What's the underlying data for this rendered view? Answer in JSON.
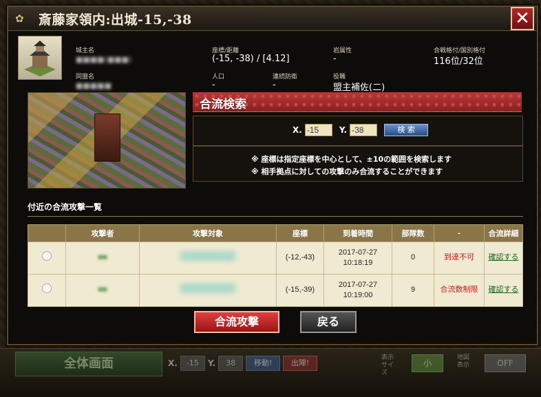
{
  "title": "斎藤家領内:出城-15,-38",
  "close_label": "✕",
  "info": {
    "owner_label": "城主名",
    "owner_value": "■■■■(■■■)",
    "alliance_label": "同盟名",
    "alliance_value": "■■■■■",
    "coords_label": "座標/距離",
    "coords_value": "(-15, -38)  /  [4.12]",
    "pop_label": "人口",
    "pop_value": "-",
    "defense_label": "連続防衛",
    "defense_value": "-",
    "rock_label": "岩属性",
    "rock_value": "-",
    "role_label": "役職",
    "role_value": "盟主補佐(二)",
    "rank_label": "合戦格付/国別格付",
    "rank_value": "116位/32位"
  },
  "search": {
    "header": "合流検索",
    "x_label": "X.",
    "x_value": "-15",
    "y_label": "Y.",
    "y_value": "-38",
    "button": "検 索",
    "note1": "※ 座標は指定座標を中心として、±10の範囲を検索します",
    "note2": "※ 相手拠点に対しての攻撃のみ合流することができます"
  },
  "list": {
    "title": "付近の合流攻撃一覧",
    "headers": [
      "",
      "攻撃者",
      "攻撃対象",
      "座標",
      "到着時間",
      "部隊数",
      "-",
      "合流詳細"
    ],
    "rows": [
      {
        "attacker": "■■",
        "target": "",
        "coords": "(-12,-43)",
        "date": "2017-07-27",
        "time": "10:18:19",
        "units": "0",
        "status": "到達不可",
        "link": "確認する"
      },
      {
        "attacker": "■■",
        "target": "",
        "coords": "(-15,-39)",
        "date": "2017-07-27",
        "time": "10:19:00",
        "units": "9",
        "status": "合流数制限",
        "link": "確認する"
      }
    ]
  },
  "buttons": {
    "join": "合流攻撃",
    "back": "戻る"
  },
  "hud": {
    "full_screen": "全体画面",
    "x_label": "X.",
    "x_value": "-15",
    "y_label": "Y.",
    "y_value": "38",
    "move": "移動!",
    "sortie": "出陣!",
    "size_label": "表示サイズ",
    "size_value": "小",
    "display_label": "地図表示",
    "display_value": "OFF"
  }
}
